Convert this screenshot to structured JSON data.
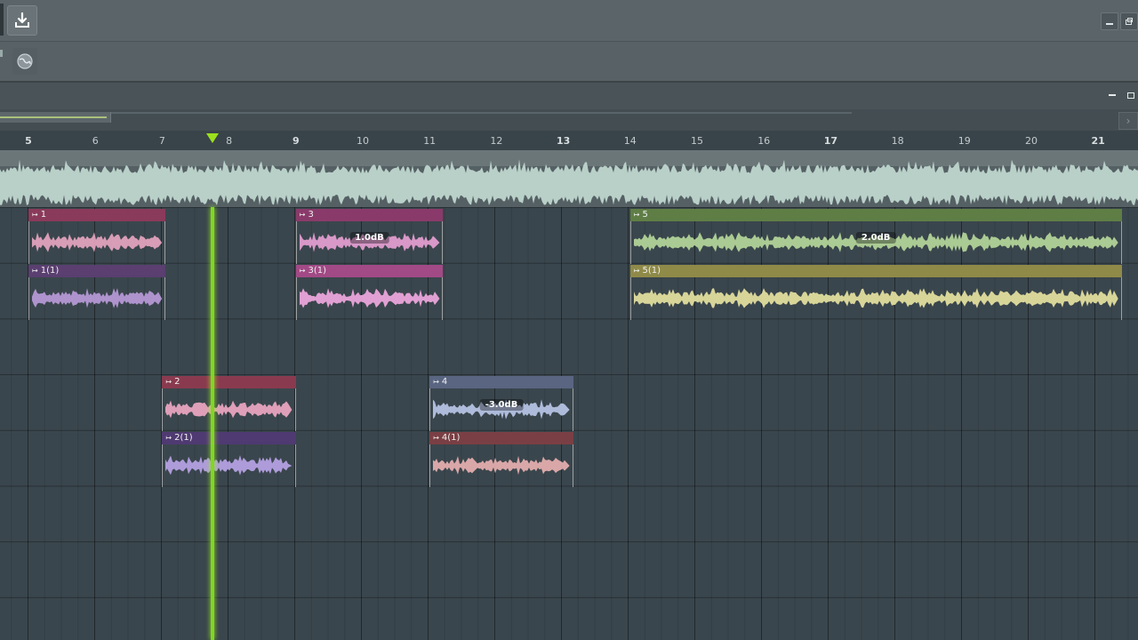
{
  "toolbar": {
    "download_icon": "download-icon",
    "globe_icon": "globe-icon",
    "minimize_icon": "minimize-icon",
    "restore_icon": "restore-icon"
  },
  "ruler": {
    "labels": [
      "5",
      "6",
      "7",
      "8",
      "9",
      "10",
      "11",
      "12",
      "13",
      "14",
      "15",
      "16",
      "17",
      "18",
      "19",
      "20",
      "21"
    ],
    "major": [
      "5",
      "9",
      "13",
      "17",
      "21"
    ]
  },
  "playhead": {
    "bar": 7.75
  },
  "clips": [
    {
      "label": "1",
      "row": 0,
      "start": 5,
      "end": 7.05,
      "header": "#8a3a5a",
      "wave": "#e6a5c0",
      "gain": ""
    },
    {
      "label": "1(1)",
      "row": 1,
      "start": 5,
      "end": 7.05,
      "header": "#5a3f70",
      "wave": "#b99ad8",
      "gain": ""
    },
    {
      "label": "3",
      "row": 0,
      "start": 9,
      "end": 11.2,
      "header": "#8a3a6a",
      "wave": "#e6a0d2",
      "gain": "1.0dB"
    },
    {
      "label": "3(1)",
      "row": 1,
      "start": 9,
      "end": 11.2,
      "header": "#a24a86",
      "wave": "#f0a8de",
      "gain": ""
    },
    {
      "label": "5",
      "row": 0,
      "start": 14,
      "end": 21.35,
      "header": "#5f7e45",
      "wave": "#b5d79a",
      "gain": "2.0dB"
    },
    {
      "label": "5(1)",
      "row": 1,
      "start": 14,
      "end": 21.35,
      "header": "#8f8a48",
      "wave": "#e6e2a0",
      "gain": ""
    },
    {
      "label": "2",
      "row": 3,
      "start": 7,
      "end": 9,
      "header": "#8a3a4f",
      "wave": "#eea7c2",
      "gain": ""
    },
    {
      "label": "2(1)",
      "row": 4,
      "start": 7,
      "end": 9,
      "header": "#4f3a72",
      "wave": "#b8a4e6",
      "gain": ""
    },
    {
      "label": "4",
      "row": 3,
      "start": 11,
      "end": 13.15,
      "header": "#5a6582",
      "wave": "#b8c6e6",
      "gain": "-3.0dB"
    },
    {
      "label": "4(1)",
      "row": 4,
      "start": 11,
      "end": 13.15,
      "header": "#7a3f44",
      "wave": "#e8b0b0",
      "gain": ""
    }
  ]
}
